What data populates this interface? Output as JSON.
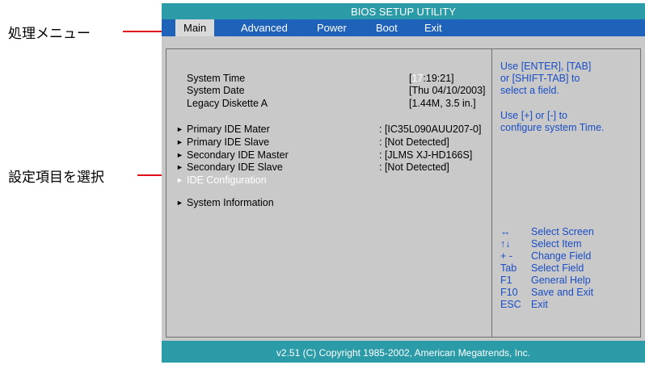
{
  "callouts": {
    "menu": "処理メニュー",
    "select": "設定項目を選択"
  },
  "bios": {
    "title": "BIOS SETUP UTILITY",
    "menu": [
      "Main",
      "Advanced",
      "Power",
      "Boot",
      "Exit"
    ],
    "active_menu": "Main",
    "settings": [
      {
        "label": "System Time",
        "value_prefix": "[",
        "value_hl": "17",
        "value_suffix": ":19:21]"
      },
      {
        "label": "System Date",
        "value": "[Thu 04/10/2003]"
      },
      {
        "label": "Legacy Diskette A",
        "value": "[1.44M, 3.5 in.]"
      }
    ],
    "submenus": [
      {
        "label": "Primary IDE Mater",
        "value": ": [IC35L090AUU207-0]"
      },
      {
        "label": "Primary IDE Slave",
        "value": ": [Not Detected]"
      },
      {
        "label": "Secondary IDE Master",
        "value": ": [JLMS XJ-HD166S]"
      },
      {
        "label": "Secondary IDE Slave",
        "value": ": [Not Detected]"
      },
      {
        "label": "IDE Configuration",
        "value": ""
      },
      {
        "label": "System Information",
        "value": ""
      }
    ],
    "help": {
      "line1": "Use [ENTER], [TAB]",
      "line2": "or [SHIFT-TAB] to",
      "line3": "select a field.",
      "line4": "Use [+] or [-] to",
      "line5": "configure system Time."
    },
    "keys": [
      {
        "key": "↔",
        "desc": "Select Screen"
      },
      {
        "key": "↑↓",
        "desc": "Select Item"
      },
      {
        "key": "+ -",
        "desc": "Change Field"
      },
      {
        "key": "Tab",
        "desc": "Select Field"
      },
      {
        "key": "F1",
        "desc": "General Help"
      },
      {
        "key": "F10",
        "desc": "Save and Exit"
      },
      {
        "key": "ESC",
        "desc": "Exit"
      }
    ],
    "footer": "v2.51 (C) Copyright 1985-2002, American Megatrends, Inc."
  },
  "colors": {
    "teal": "#2b9ba8",
    "menu_blue": "#1f62b9",
    "panel_gray": "#c9c9c9",
    "help_blue": "#1a4ec6",
    "callout_red": "#e0101a"
  }
}
